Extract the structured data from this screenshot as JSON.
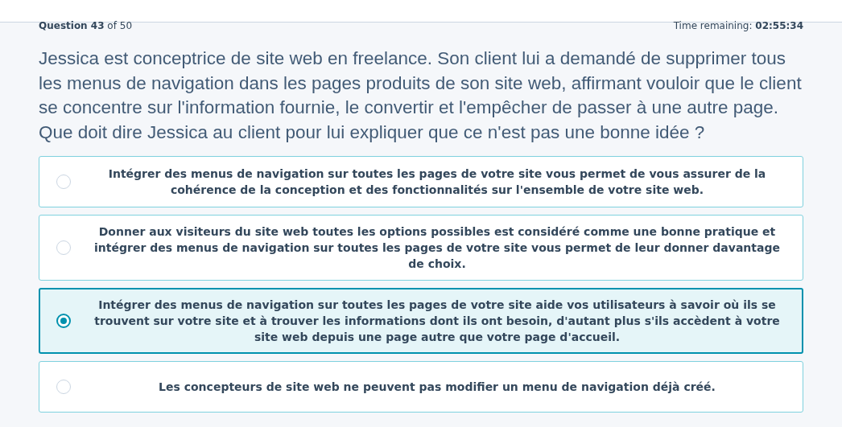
{
  "progress": "**Question 43** of 50",
  "timer": "Time remaining: **02:55:34**",
  "question": "Jessica est conceptrice de site web en freelance. Son client lui a demandé de supprimer tous les menus de navigation dans les pages produits de son site web, affirmant vouloir que le client se concentre sur l'information fournie, le convertir et l'empêcher de passer à une autre page. Que doit dire Jessica au client pour lui expliquer que ce n'est pas une bonne idée ?",
  "options": [
    {
      "text": "Intégrer des menus de navigation sur toutes les pages de votre site vous permet de vous assurer de la cohérence de la conception et des fonctionnalités sur l'ensemble de votre site web.",
      "selected": false
    },
    {
      "text": "Donner aux visiteurs du site web toutes les options possibles est considéré comme une bonne pratique et intégrer des menus de navigation sur toutes les pages de votre site vous permet de leur donner davantage de choix.",
      "selected": false
    },
    {
      "text": "Intégrer des menus de navigation sur toutes les pages de votre site aide vos utilisateurs à savoir où ils se trouvent sur votre site et à trouver les informations dont ils ont besoin, d'autant plus s'ils accèdent à votre site web depuis une page autre que votre page d'accueil.",
      "selected": true
    },
    {
      "text": "Les concepteurs de site web ne peuvent pas modifier un menu de navigation déjà créé.",
      "selected": false
    }
  ]
}
